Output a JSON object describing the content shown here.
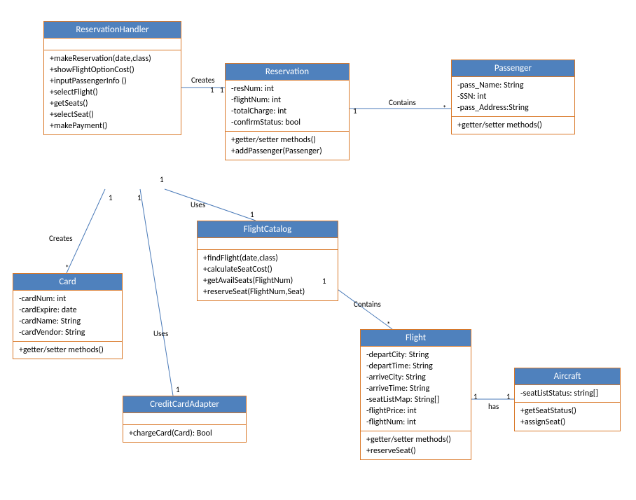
{
  "classes": {
    "reservationHandler": {
      "name": "ReservationHandler",
      "attrs": [],
      "methods": [
        "+makeReservation(date,class)",
        "+showFlightOptionCost()",
        "+inputPassengerInfo ()",
        "+selectFlight()",
        "+getSeats()",
        "+selectSeat()",
        "+makePayment()"
      ]
    },
    "reservation": {
      "name": "Reservation",
      "attrs": [
        "-resNum: int",
        "-flightNum: int",
        "-totalCharge: int",
        "-confirmStatus: bool"
      ],
      "methods": [
        "+getter/setter methods()",
        "+addPassenger(Passenger)"
      ]
    },
    "passenger": {
      "name": "Passenger",
      "attrs": [
        "-pass_Name: String",
        "-SSN: int",
        "-pass_Address:String"
      ],
      "methods": [
        "+getter/setter methods()"
      ]
    },
    "card": {
      "name": "Card",
      "attrs": [
        "-cardNum: int",
        "-cardExpire: date",
        "-cardName: String",
        "-cardVendor: String"
      ],
      "methods": [
        "+getter/setter methods()"
      ]
    },
    "flightCatalog": {
      "name": "FlightCatalog",
      "attrs": [],
      "methods": [
        "+findFlight(date,class)",
        "+calculateSeatCost()",
        "+getAvailSeats(FlightNum)",
        "+reserveSeat(FlightNum,Seat)"
      ]
    },
    "creditCardAdapter": {
      "name": "CreditCardAdapter",
      "attrs": [],
      "methods": [
        "+chargeCard(Card): Bool"
      ]
    },
    "flight": {
      "name": "Flight",
      "attrs": [
        "-departCity: String",
        "-departTime: String",
        "-arriveCity: String",
        "-arriveTime: String",
        "-seatListMap: String[]",
        "-flightPrice: int",
        "-flightNum: int"
      ],
      "methods": [
        "+getter/setter methods()",
        "+reserveSeat()"
      ]
    },
    "aircraft": {
      "name": "Aircraft",
      "attrs": [
        "-seatListStatus: string[]"
      ],
      "methods": [
        "+getSeatStatus()",
        "+assignSeat()"
      ]
    }
  },
  "labels": {
    "creates1": "Creates",
    "creates2": "Creates",
    "uses1": "Uses",
    "uses2": "Uses",
    "contains1": "Contains",
    "contains2": "Contains",
    "has": "has",
    "one": "1",
    "star": "*"
  }
}
